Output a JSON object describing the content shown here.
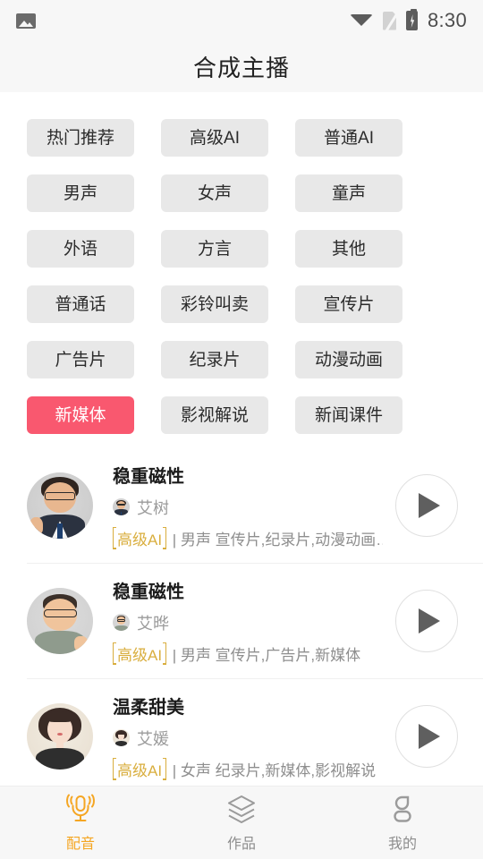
{
  "statusbar": {
    "time": "8:30",
    "icons": [
      "photo-icon",
      "wifi-icon",
      "sim-off-icon",
      "battery-charging-icon"
    ]
  },
  "header": {
    "title": "合成主播"
  },
  "categories": [
    {
      "label": "热门推荐",
      "active": false
    },
    {
      "label": "高级AI",
      "active": false
    },
    {
      "label": "普通AI",
      "active": false
    },
    {
      "label": "男声",
      "active": false
    },
    {
      "label": "女声",
      "active": false
    },
    {
      "label": "童声",
      "active": false
    },
    {
      "label": "外语",
      "active": false
    },
    {
      "label": "方言",
      "active": false
    },
    {
      "label": "其他",
      "active": false
    },
    {
      "label": "普通话",
      "active": false
    },
    {
      "label": "彩铃叫卖",
      "active": false
    },
    {
      "label": "宣传片",
      "active": false
    },
    {
      "label": "广告片",
      "active": false
    },
    {
      "label": "纪录片",
      "active": false
    },
    {
      "label": "动漫动画",
      "active": false
    },
    {
      "label": "新媒体",
      "active": true
    },
    {
      "label": "影视解说",
      "active": false
    },
    {
      "label": "新闻课件",
      "active": false
    }
  ],
  "voices": [
    {
      "name": "稳重磁性",
      "alias": "艾树",
      "tag": "高级AI",
      "meta": "| 男声 宣传片,纪录片,动漫动画…",
      "play": "play-icon"
    },
    {
      "name": "稳重磁性",
      "alias": "艾晔",
      "tag": "高级AI",
      "meta": "| 男声 宣传片,广告片,新媒体",
      "play": "play-icon"
    },
    {
      "name": "温柔甜美",
      "alias": "艾媛",
      "tag": "高级AI",
      "meta": "| 女声 纪录片,新媒体,影视解说",
      "play": "play-icon"
    }
  ],
  "tabbar": [
    {
      "label": "配音",
      "icon": "microphone-icon",
      "active": true
    },
    {
      "label": "作品",
      "icon": "layers-icon",
      "active": false
    },
    {
      "label": "我的",
      "icon": "person-icon",
      "active": false
    }
  ],
  "colors": {
    "accent_selected": "#f9586f",
    "tab_active": "#f5a623",
    "tag_gold": "#d9ae3e",
    "chip_bg": "#e8e8e8",
    "bar_bg": "#f7f7f7"
  }
}
